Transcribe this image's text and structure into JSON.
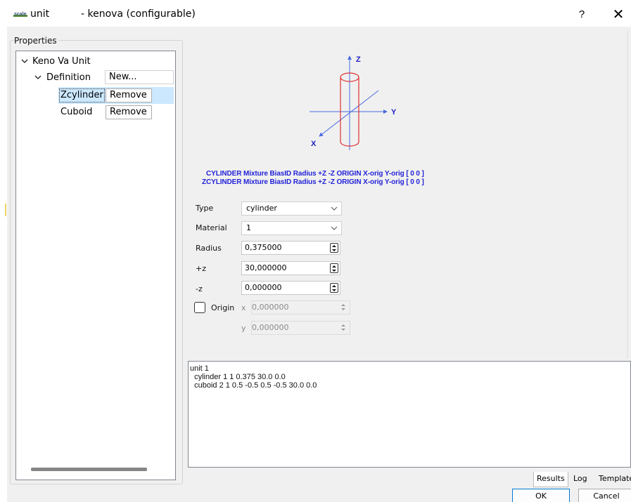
{
  "window": {
    "app_name": "unit",
    "file_title": "- kenova (configurable)",
    "help_label": "?",
    "close_label": "✕"
  },
  "properties": {
    "label": "Properties",
    "tree": {
      "root": "Keno Va Unit",
      "definition": "Definition",
      "new_button": "New...",
      "items": [
        {
          "name": "Zcylinder",
          "button": "Remove"
        },
        {
          "name": "Cuboid",
          "button": "Remove"
        }
      ]
    }
  },
  "diagram": {
    "axis_z": "Z",
    "axis_y": "Y",
    "axis_x": "X",
    "syntax_line1": "CYLINDER Mixture  BiasID   Radius  +Z  -Z  ORIGIN  X-orig  Y-orig [ 0 0 ]",
    "syntax_line2": "ZCYLINDER Mixture  BiasID   Radius  +Z  -Z  ORIGIN  X-orig  Y-orig [ 0 0 ]"
  },
  "form": {
    "type_label": "Type",
    "type_value": "cylinder",
    "material_label": "Material",
    "material_value": "1",
    "radius_label": "Radius",
    "radius_value": "0,375000",
    "pz_label": "+z",
    "pz_value": "30,000000",
    "mz_label": "-z",
    "mz_value": "0,000000",
    "origin_label": "Origin",
    "origin_checked": false,
    "origin_x_label": "x",
    "origin_x_value": "0,000000",
    "origin_y_label": "y",
    "origin_y_value": "0,000000"
  },
  "results_text": "unit 1\n  cylinder 1 1 0.375 30.0 0.0\n  cuboid 2 1 0.5 -0.5 0.5 -0.5 30.0 0.0",
  "tabs": {
    "results": "Results",
    "log": "Log",
    "template": "Template"
  },
  "buttons": {
    "ok": "OK",
    "cancel": "Cancel"
  },
  "colors": {
    "syntax_text": "#2222d8",
    "axis": "#4a6be0",
    "cylinder": "#e03030",
    "selection": "#cce8ff",
    "default_button_border": "#0078d7"
  }
}
